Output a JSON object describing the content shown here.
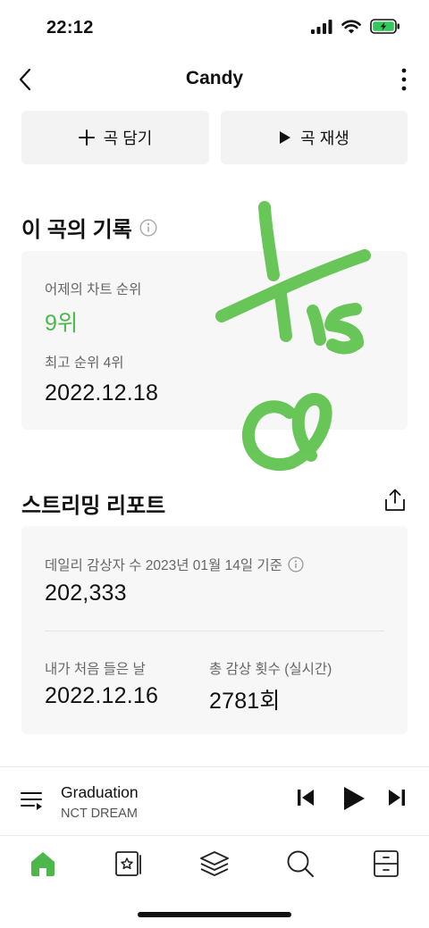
{
  "status_bar": {
    "time": "22:12",
    "battery_color": "#34c759"
  },
  "nav": {
    "title": "Candy",
    "back_icon": "chevron-left-icon",
    "more_icon": "more-vertical-icon"
  },
  "actions": {
    "add_label": "곡 담기",
    "add_icon": "plus-icon",
    "play_label": "곡 재생",
    "play_icon": "play-icon"
  },
  "record_section": {
    "title": "이 곡의 기록",
    "info_icon": "info-icon",
    "yesterday_label": "어제의 차트 순위",
    "yesterday_rank": "9위",
    "best_label": "최고 순위 4위",
    "best_date": "2022.12.18"
  },
  "streaming_report": {
    "title": "스트리밍 리포트",
    "share_icon": "share-icon",
    "daily_label": "데일리 감상자 수 2023년 01월 14일 기준",
    "daily_value": "202,333",
    "first_listen_label": "내가 처음 들은 날",
    "first_listen_value": "2022.12.16",
    "total_plays_label": "총 감상 횟수 (실시간)",
    "total_plays_value": "2781회"
  },
  "mini_player": {
    "title": "Graduation",
    "artist": "NCT DREAM"
  },
  "tabs": [
    {
      "name": "home",
      "icon": "home-icon",
      "active": true
    },
    {
      "name": "library",
      "icon": "music-card-icon",
      "active": false
    },
    {
      "name": "playlist",
      "icon": "layers-icon",
      "active": false
    },
    {
      "name": "search",
      "icon": "search-icon",
      "active": false
    },
    {
      "name": "storage",
      "icon": "drawer-icon",
      "active": false
    }
  ],
  "colors": {
    "accent_green": "#4cb84c",
    "card_bg": "#f7f7f7",
    "button_bg": "#f3f3f3"
  }
}
